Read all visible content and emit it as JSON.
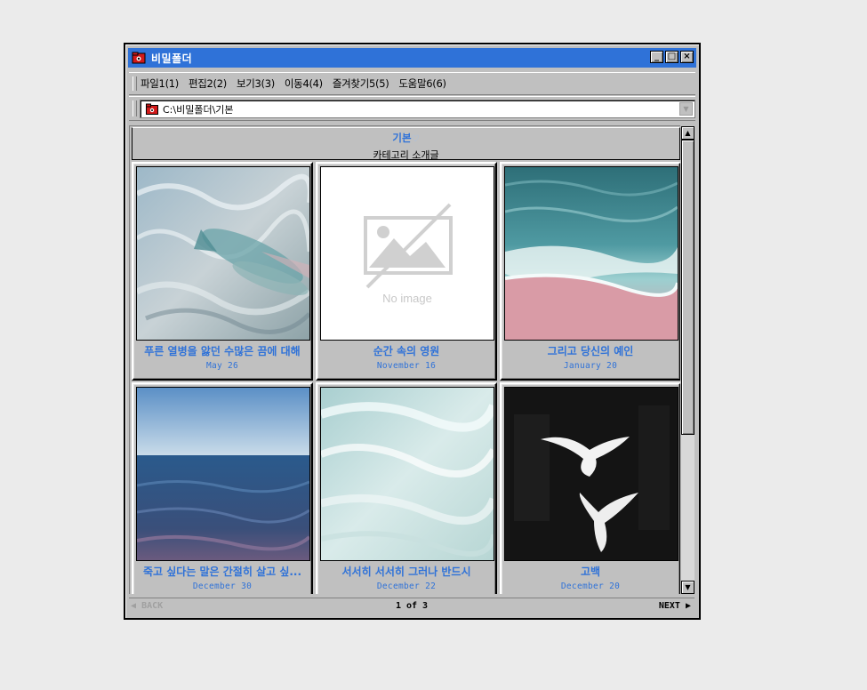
{
  "window": {
    "title": "비밀폴더"
  },
  "window_buttons": {
    "minimize": "_",
    "maximize": "□",
    "close": "×"
  },
  "menu": [
    "파일1(1)",
    "편집2(2)",
    "보기3(3)",
    "이동4(4)",
    "즐겨찾기5(5)",
    "도움말6(6)"
  ],
  "address": {
    "path": "C:\\비밀폴더\\기본"
  },
  "category": {
    "name": "기본",
    "heart": "♡",
    "description": "카테고리 소개글"
  },
  "no_image_text": "No image",
  "posts": [
    {
      "title": "푸른 열병을 앓던 수많은 끔에 대해",
      "date": "May 26",
      "image": "fish-water"
    },
    {
      "title": "순간 속의 영원",
      "date": "November 16",
      "image": "no-image"
    },
    {
      "title": "그리고 당신의 예인",
      "date": "January 20",
      "image": "waves-pink-sand"
    },
    {
      "title": "죽고 싶다는 말은 간절히 살고 싶...",
      "date": "December 30",
      "image": "sea-horizon"
    },
    {
      "title": "서서히 서서히 그러나 반드시",
      "date": "December 22",
      "image": "white-surf"
    },
    {
      "title": "고백",
      "date": "December 20",
      "image": "white-doves"
    }
  ],
  "pagination": {
    "back": "BACK",
    "page": "1 of 3",
    "next": "NEXT"
  },
  "colors": {
    "titlebar": "#2f72d8",
    "link": "#2f72d8",
    "chrome": "#c0c0c0",
    "desktop": "#ebebeb"
  }
}
